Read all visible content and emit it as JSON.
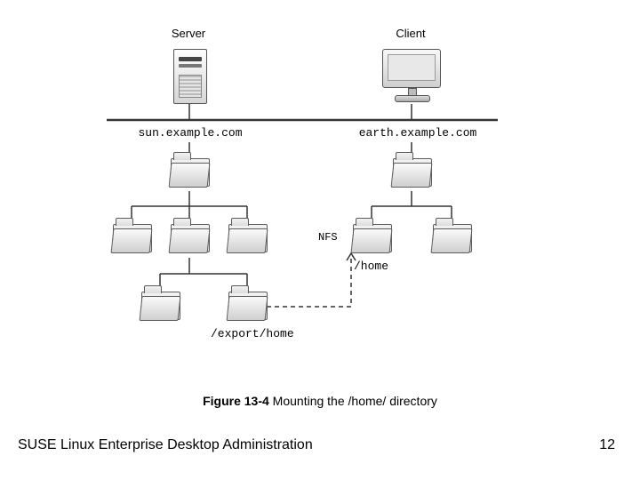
{
  "header": {
    "server_label": "Server",
    "client_label": "Client"
  },
  "hosts": {
    "server_hostname": "sun.example.com",
    "client_hostname": "earth.example.com"
  },
  "paths": {
    "client_home": "/home",
    "server_export_home": "/export/home"
  },
  "link": {
    "protocol": "NFS"
  },
  "caption": {
    "figure_ref": "Figure 13-4",
    "figure_text": " Mounting the /home/ directory"
  },
  "footer": {
    "book_title": "SUSE Linux Enterprise Desktop Administration",
    "page_number": "12"
  }
}
